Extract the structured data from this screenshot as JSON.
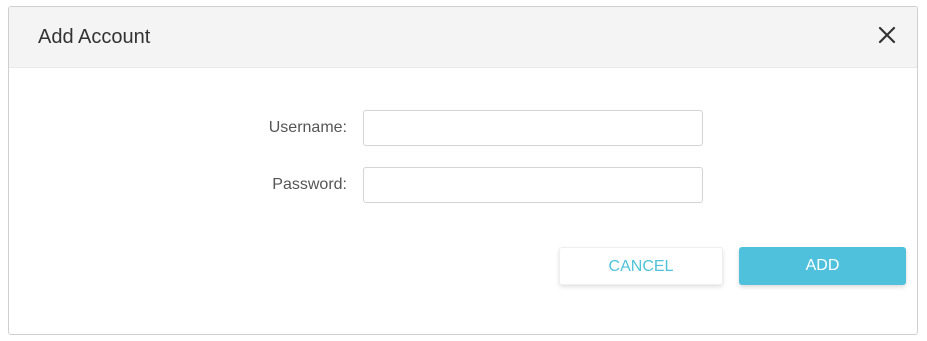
{
  "dialog": {
    "title": "Add Account",
    "close_icon": "close-icon"
  },
  "form": {
    "username": {
      "label": "Username:",
      "value": "",
      "placeholder": ""
    },
    "password": {
      "label": "Password:",
      "value": "",
      "placeholder": ""
    }
  },
  "actions": {
    "cancel_label": "CANCEL",
    "add_label": "ADD"
  },
  "colors": {
    "accent": "#4fc1dc",
    "header_bg": "#f4f4f4"
  }
}
